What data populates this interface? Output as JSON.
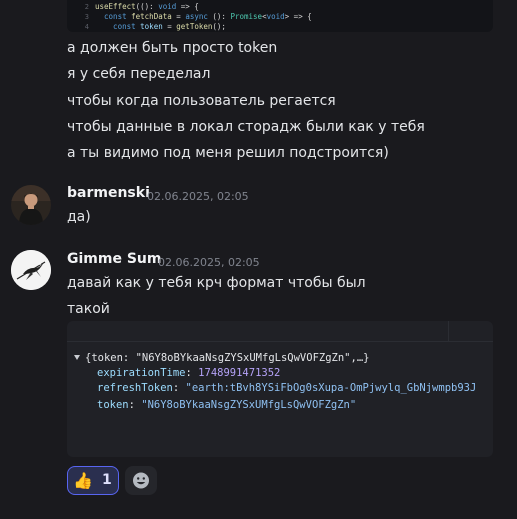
{
  "code_snippet": {
    "lines": [
      {
        "num": "2",
        "text": "useEffect((): void => {"
      },
      {
        "num": "3",
        "text": "  const fetchData = async (): Promise<void> => {"
      },
      {
        "num": "4",
        "text": "    const token = getToken();"
      }
    ]
  },
  "message_continuation": {
    "lines": [
      "а должен быть просто token",
      "я у себя переделал",
      "чтобы когда пользователь регается",
      "чтобы данные в локал сторадж были как у тебя",
      "а ты видимо под меня решил подстроится)"
    ]
  },
  "message_barmenski": {
    "username": "barmenski",
    "timestamp": "02.06.2025, 02:05",
    "text": "да)"
  },
  "message_gimme": {
    "username": "Gimme Sum",
    "timestamp": "02.06.2025, 02:05",
    "text_lines": [
      "давай как у тебя крч формат чтобы был",
      "такой"
    ],
    "json_preview": {
      "head": "{token: \"N6Y8oBYkaaNsgZYSxUMfgLsQwVOFZgZn\",…}",
      "fields": [
        {
          "key": "expirationTime",
          "value": "1748991471352",
          "kind": "num"
        },
        {
          "key": "refreshToken",
          "value": "\"earth:tBvh8YSiFbOg0sXupa-OmPjwylq_GbNjwmpb93J",
          "kind": "str"
        },
        {
          "key": "token",
          "value": "\"N6Y8oBYkaaNsgZYSxUMfgLsQwVOFZgZn\"",
          "kind": "str"
        }
      ]
    },
    "reaction": {
      "emoji": "👍",
      "count": "1"
    }
  },
  "colors": {
    "background": "#1a1a1e",
    "accent": "#5865f2",
    "username": "#f2f3f5",
    "timestamp": "#80848e"
  }
}
